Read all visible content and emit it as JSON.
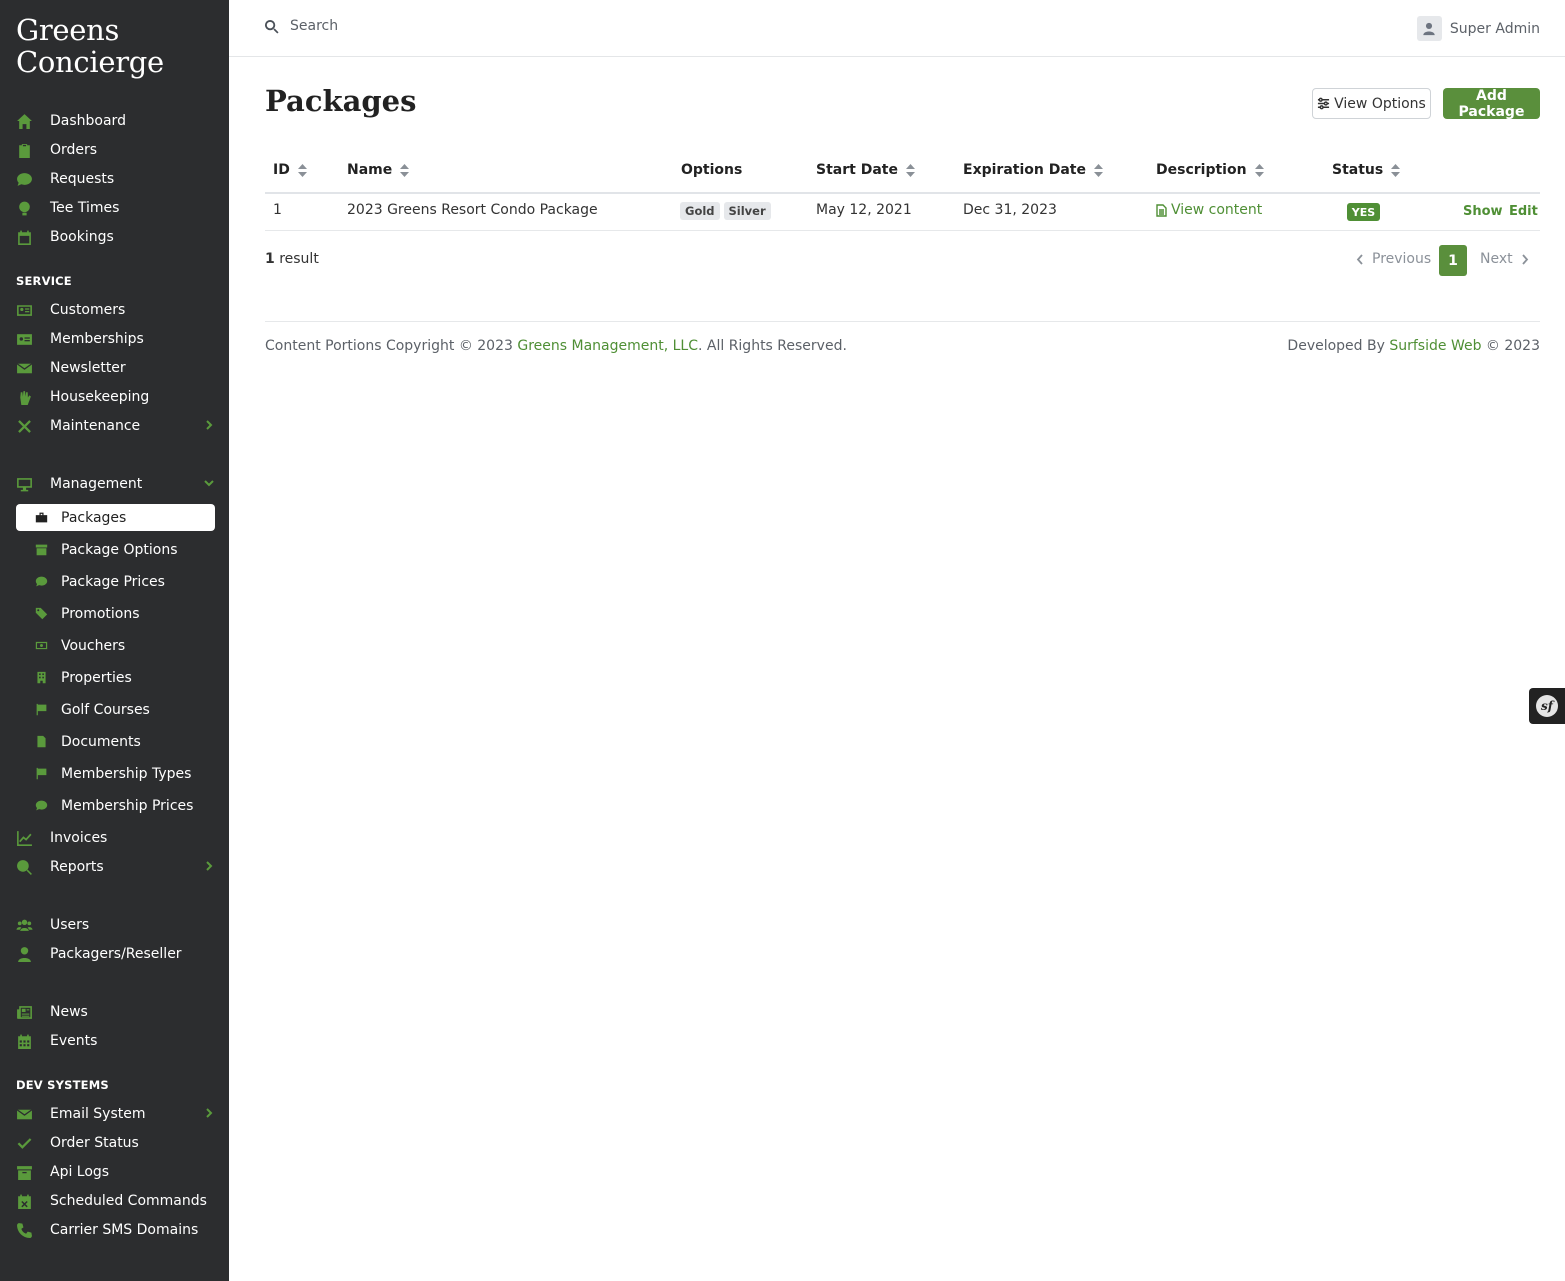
{
  "brand": {
    "line1": "Greens",
    "line2": "Concierge"
  },
  "sidebar": {
    "main": [
      {
        "label": "Dashboard",
        "icon": "home-icon"
      },
      {
        "label": "Orders",
        "icon": "clipboard-icon"
      },
      {
        "label": "Requests",
        "icon": "comment-dollar-icon"
      },
      {
        "label": "Tee Times",
        "icon": "golf-ball-icon"
      },
      {
        "label": "Bookings",
        "icon": "calendar-check-icon"
      }
    ],
    "service_heading": "SERVICE",
    "service": [
      {
        "label": "Customers",
        "icon": "address-card-icon"
      },
      {
        "label": "Memberships",
        "icon": "id-card-icon"
      },
      {
        "label": "Newsletter",
        "icon": "envelope-icon"
      },
      {
        "label": "Housekeeping",
        "icon": "hand-sparkles-icon"
      },
      {
        "label": "Maintenance",
        "icon": "tools-icon",
        "chevron": "right"
      }
    ],
    "management": {
      "label": "Management",
      "icon": "desktop-icon",
      "chevron": "down"
    },
    "management_items": [
      {
        "label": "Packages",
        "icon": "briefcase-icon",
        "active": true
      },
      {
        "label": "Package Options",
        "icon": "box-icon"
      },
      {
        "label": "Package Prices",
        "icon": "comment-dollar-icon"
      },
      {
        "label": "Promotions",
        "icon": "tags-icon"
      },
      {
        "label": "Vouchers",
        "icon": "money-bill-icon"
      },
      {
        "label": "Properties",
        "icon": "building-icon"
      },
      {
        "label": "Golf Courses",
        "icon": "flag-icon"
      },
      {
        "label": "Documents",
        "icon": "file-icon"
      },
      {
        "label": "Membership Types",
        "icon": "flag-icon"
      },
      {
        "label": "Membership Prices",
        "icon": "comment-dollar-icon"
      }
    ],
    "after_management": [
      {
        "label": "Invoices",
        "icon": "chart-line-icon"
      },
      {
        "label": "Reports",
        "icon": "search-dollar-icon",
        "chevron": "right"
      }
    ],
    "people": [
      {
        "label": "Users",
        "icon": "users-icon"
      },
      {
        "label": "Packagers/Reseller",
        "icon": "user-tie-icon"
      }
    ],
    "content": [
      {
        "label": "News",
        "icon": "newspaper-icon"
      },
      {
        "label": "Events",
        "icon": "calendar-icon"
      }
    ],
    "dev_heading": "DEV SYSTEMS",
    "dev": [
      {
        "label": "Email System",
        "icon": "envelope-icon",
        "chevron": "right"
      },
      {
        "label": "Order Status",
        "icon": "check-icon"
      },
      {
        "label": "Api Logs",
        "icon": "archive-icon"
      },
      {
        "label": "Scheduled Commands",
        "icon": "calendar-times-icon"
      },
      {
        "label": "Carrier SMS Domains",
        "icon": "phone-icon"
      }
    ]
  },
  "topbar": {
    "search_placeholder": "Search",
    "user_name": "Super Admin"
  },
  "page": {
    "title": "Packages",
    "view_options_label": "View Options",
    "add_label": "Add Package"
  },
  "table": {
    "columns": [
      "ID",
      "Name",
      "Options",
      "Start Date",
      "Expiration Date",
      "Description",
      "Status"
    ],
    "rows": [
      {
        "id": "1",
        "name": "2023 Greens Resort Condo Package",
        "options": [
          "Gold",
          "Silver"
        ],
        "start_date": "May 12, 2021",
        "expiration_date": "Dec 31, 2023",
        "description": "View content",
        "status": "YES",
        "actions": [
          "Show",
          "Edit"
        ]
      }
    ]
  },
  "pagination": {
    "result_count": "1",
    "result_label": "result",
    "previous": "Previous",
    "current": "1",
    "next": "Next"
  },
  "footer": {
    "left_prefix": "Content Portions Copyright © 2023 ",
    "left_link": "Greens Management, LLC",
    "left_suffix": ". All Rights Reserved.",
    "right_prefix": "Developed By ",
    "right_link": "Surfside Web",
    "right_suffix": " © 2023"
  },
  "colors": {
    "sidebar_bg": "#2c2d2f",
    "accent": "#5a8f3c",
    "link": "#4f8f35"
  },
  "debug_toolbar_icon": "symfony-icon"
}
